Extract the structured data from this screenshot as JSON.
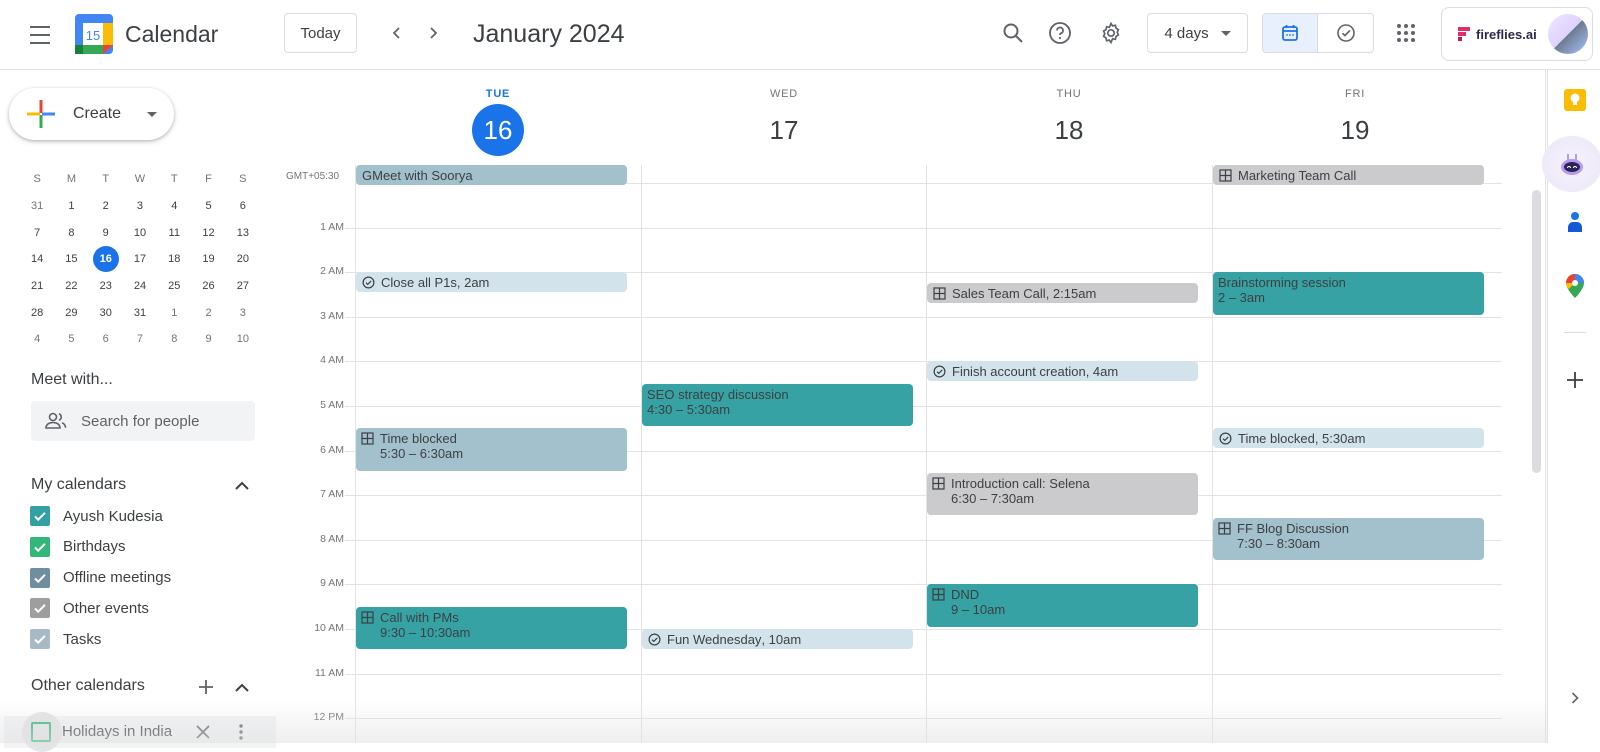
{
  "header": {
    "app_title": "Calendar",
    "logo_day": "15",
    "today_label": "Today",
    "month_title": "January 2024",
    "view_select": "4 days",
    "account_brand": "fireflies.ai"
  },
  "sidebar": {
    "create_label": "Create",
    "mini_calendar": {
      "weekday_headers": [
        "S",
        "M",
        "T",
        "W",
        "T",
        "F",
        "S"
      ],
      "weeks": [
        [
          "31",
          "1",
          "2",
          "3",
          "4",
          "5",
          "6"
        ],
        [
          "7",
          "8",
          "9",
          "10",
          "11",
          "12",
          "13"
        ],
        [
          "14",
          "15",
          "16",
          "17",
          "18",
          "19",
          "20"
        ],
        [
          "21",
          "22",
          "23",
          "24",
          "25",
          "26",
          "27"
        ],
        [
          "28",
          "29",
          "30",
          "31",
          "1",
          "2",
          "3"
        ],
        [
          "4",
          "5",
          "6",
          "7",
          "8",
          "9",
          "10"
        ]
      ],
      "today": "16"
    },
    "meet_with_title": "Meet with...",
    "people_search_placeholder": "Search for people",
    "my_calendars_title": "My calendars",
    "my_calendars": [
      {
        "label": "Ayush Kudesia",
        "checked": true,
        "color": "#33a0a4"
      },
      {
        "label": "Birthdays",
        "checked": true,
        "color": "#33b679"
      },
      {
        "label": "Offline meetings",
        "checked": true,
        "color": "#6f8fa0"
      },
      {
        "label": "Other events",
        "checked": true,
        "color": "#9e9e9e"
      },
      {
        "label": "Tasks",
        "checked": true,
        "color": "#a6b9c4"
      }
    ],
    "other_calendars_title": "Other calendars",
    "other_calendars": [
      {
        "label": "Holidays in India",
        "checked": false,
        "color": "#33b679"
      }
    ]
  },
  "week": {
    "timezone": "GMT+05:30",
    "days": [
      {
        "dow": "TUE",
        "date": "16",
        "today": true
      },
      {
        "dow": "WED",
        "date": "17",
        "today": false
      },
      {
        "dow": "THU",
        "date": "18",
        "today": false
      },
      {
        "dow": "FRI",
        "date": "19",
        "today": false
      }
    ],
    "hour_labels": [
      "1 AM",
      "2 AM",
      "3 AM",
      "4 AM",
      "5 AM",
      "6 AM",
      "7 AM",
      "8 AM",
      "9 AM",
      "10 AM",
      "11 AM",
      "12 PM"
    ]
  },
  "colors": {
    "teal": "#37a2a4",
    "slate": "#a3c0cd",
    "gray": "#cbcbcd",
    "task": "#d3e3ec",
    "today_blue": "#1a73e8"
  },
  "events": [
    {
      "day": 0,
      "title": "GMeet with Soorya",
      "time": "",
      "start": -0.25,
      "end": 0.2,
      "style": "slate",
      "icon": "",
      "layout": "single"
    },
    {
      "day": 0,
      "title": "Close all P1s",
      "time": ", 2am",
      "start": 2.0,
      "end": 2.45,
      "style": "task",
      "icon": "task-check-icon",
      "layout": "single"
    },
    {
      "day": 0,
      "title": "Time blocked",
      "time": "5:30 – 6:30am",
      "start": 5.5,
      "end": 6.45,
      "style": "slate",
      "icon": "grid-icon",
      "layout": "double"
    },
    {
      "day": 0,
      "title": "Call with PMs",
      "time": "9:30 – 10:30am",
      "start": 9.5,
      "end": 10.45,
      "style": "teal",
      "icon": "grid-icon",
      "layout": "double"
    },
    {
      "day": 1,
      "title": "SEO strategy discussion",
      "time": "4:30 – 5:30am",
      "start": 4.5,
      "end": 5.45,
      "style": "teal",
      "icon": "",
      "layout": "double"
    },
    {
      "day": 1,
      "title": "Fun Wednesday",
      "time": ", 10am",
      "start": 10.0,
      "end": 10.45,
      "style": "task",
      "icon": "task-check-icon",
      "layout": "single"
    },
    {
      "day": 2,
      "title": "Sales Team Call",
      "time": ", 2:15am",
      "start": 2.25,
      "end": 2.7,
      "style": "gray",
      "icon": "grid-icon",
      "layout": "single"
    },
    {
      "day": 2,
      "title": "Finish account creation",
      "time": ", 4am",
      "start": 4.0,
      "end": 4.45,
      "style": "task",
      "icon": "task-check-icon",
      "layout": "single"
    },
    {
      "day": 2,
      "title": "Introduction call: Selena",
      "time": "6:30 – 7:30am",
      "start": 6.5,
      "end": 7.45,
      "style": "gray",
      "icon": "grid-icon",
      "layout": "double"
    },
    {
      "day": 2,
      "title": "DND",
      "time": "9 – 10am",
      "start": 9.0,
      "end": 9.95,
      "style": "teal",
      "icon": "grid-icon",
      "layout": "double"
    },
    {
      "day": 3,
      "title": "Marketing Team Call",
      "time": "",
      "start": -0.25,
      "end": 0.2,
      "style": "gray",
      "icon": "grid-icon",
      "layout": "single"
    },
    {
      "day": 3,
      "title": "Brainstorming session",
      "time": "2 – 3am",
      "start": 2.0,
      "end": 2.95,
      "style": "teal",
      "icon": "",
      "layout": "double"
    },
    {
      "day": 3,
      "title": "Time blocked",
      "time": ", 5:30am",
      "start": 5.5,
      "end": 5.95,
      "style": "task",
      "icon": "task-check-icon",
      "layout": "single"
    },
    {
      "day": 3,
      "title": "FF Blog Discussion",
      "time": "7:30 – 8:30am",
      "start": 7.5,
      "end": 8.45,
      "style": "slate",
      "icon": "grid-icon",
      "layout": "double"
    }
  ],
  "right_rail": [
    "keep-icon",
    "fireflies-bot-icon",
    "contacts-icon",
    "maps-icon",
    "add-addon-icon"
  ]
}
